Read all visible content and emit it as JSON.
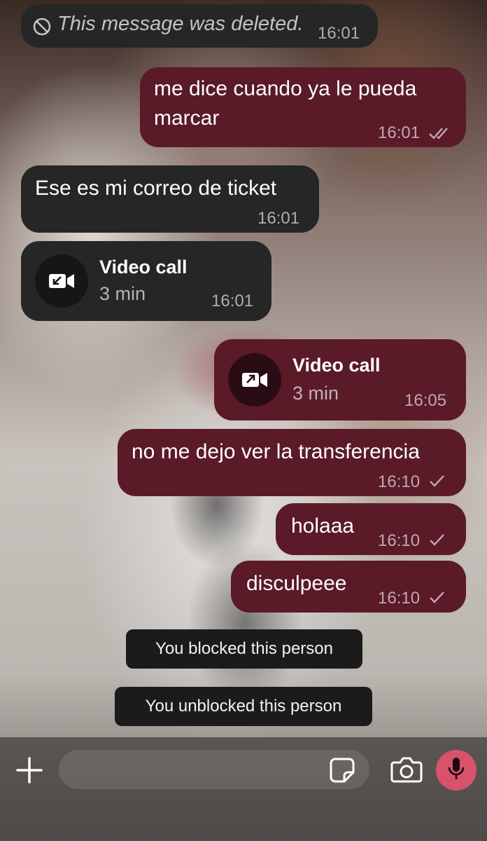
{
  "messages": [
    {
      "type": "deleted",
      "direction": "in",
      "text": "This message was deleted.",
      "time": "16:01"
    },
    {
      "type": "text",
      "direction": "out",
      "text_line1": "me dice cuando ya le pueda",
      "text_line2": "marcar",
      "time": "16:01",
      "status": "read-double-tick"
    },
    {
      "type": "text",
      "direction": "in",
      "text": "Ese es mi correo de ticket",
      "time": "16:01"
    },
    {
      "type": "call",
      "direction": "in",
      "title": "Video call",
      "duration": "3 min",
      "time": "16:01",
      "icon": "incoming-video-call-icon"
    },
    {
      "type": "call",
      "direction": "out",
      "title": "Video call",
      "duration": "3 min",
      "time": "16:05",
      "icon": "outgoing-video-call-icon"
    },
    {
      "type": "text",
      "direction": "out",
      "text": "no me dejo ver la transferencia",
      "time": "16:10",
      "status": "sent-single-tick"
    },
    {
      "type": "text",
      "direction": "out",
      "text": "holaaa",
      "time": "16:10",
      "status": "sent-single-tick"
    },
    {
      "type": "text",
      "direction": "out",
      "text": "disculpeee",
      "time": "16:10",
      "status": "sent-single-tick"
    }
  ],
  "notices": [
    {
      "text": "You blocked this person"
    },
    {
      "text": "You unblocked this person"
    }
  ],
  "composer": {
    "placeholder": "",
    "icons": [
      "plus-icon",
      "sticker-icon",
      "camera-icon",
      "microphone-icon"
    ]
  },
  "colors": {
    "incoming_bubble": "#262626",
    "outgoing_bubble": "#5a1a28",
    "mic_button": "#d8536a"
  }
}
